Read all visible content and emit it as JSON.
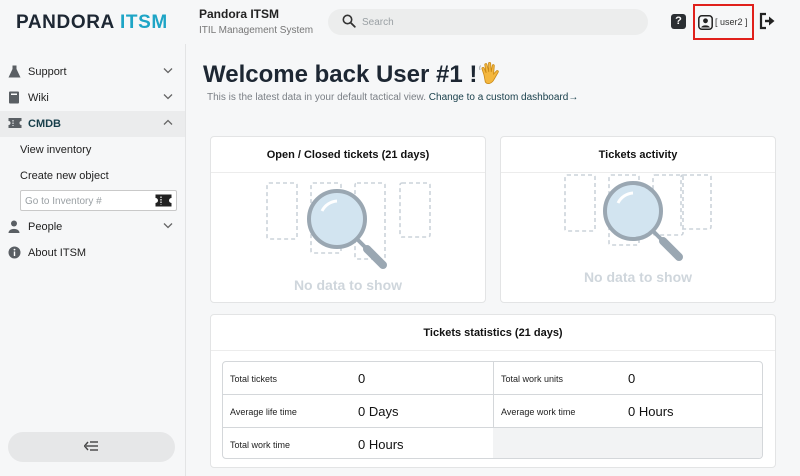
{
  "header": {
    "logo_main": "PANDORA ",
    "logo_accent": "ITSM",
    "app_title": "Pandora ITSM",
    "app_subtitle": "ITIL Management System",
    "search_placeholder": "Search",
    "help_label": "?",
    "user_label": "[ user2 ]",
    "colors": {
      "accent": "#1ea5c6",
      "highlight_border": "#e0201b"
    }
  },
  "sidebar": {
    "items": [
      {
        "label": "Support",
        "icon": "flask-icon"
      },
      {
        "label": "Wiki",
        "icon": "book-icon"
      },
      {
        "label": "CMDB",
        "icon": "ticket-icon",
        "active": true
      },
      {
        "label": "People",
        "icon": "person-icon"
      },
      {
        "label": "About ITSM",
        "icon": "info-icon"
      }
    ],
    "cmdb_sub": {
      "view_inventory": "View inventory",
      "create_object": "Create new object",
      "inventory_placeholder": "Go to Inventory #"
    }
  },
  "main": {
    "welcome_title": "Welcome back User #1 !",
    "welcome_sub": "This is the latest data in your default tactical view.",
    "welcome_link": "Change to a custom dashboard→",
    "open_closed": {
      "title": "Open / Closed tickets (21 days)",
      "empty": "No data to show"
    },
    "activity": {
      "title": "Tickets activity",
      "empty": "No data to show"
    },
    "stats": {
      "title": "Tickets statistics (21 days)",
      "rows": [
        {
          "label_left": "Total tickets",
          "value_left": "0",
          "label_right": "Total work units",
          "value_right": "0"
        },
        {
          "label_left": "Average life time",
          "value_left": "0 Days",
          "label_right": "Average work time",
          "value_right": "0 Hours"
        },
        {
          "label_left": "Total work time",
          "value_left": "0 Hours"
        }
      ]
    }
  }
}
